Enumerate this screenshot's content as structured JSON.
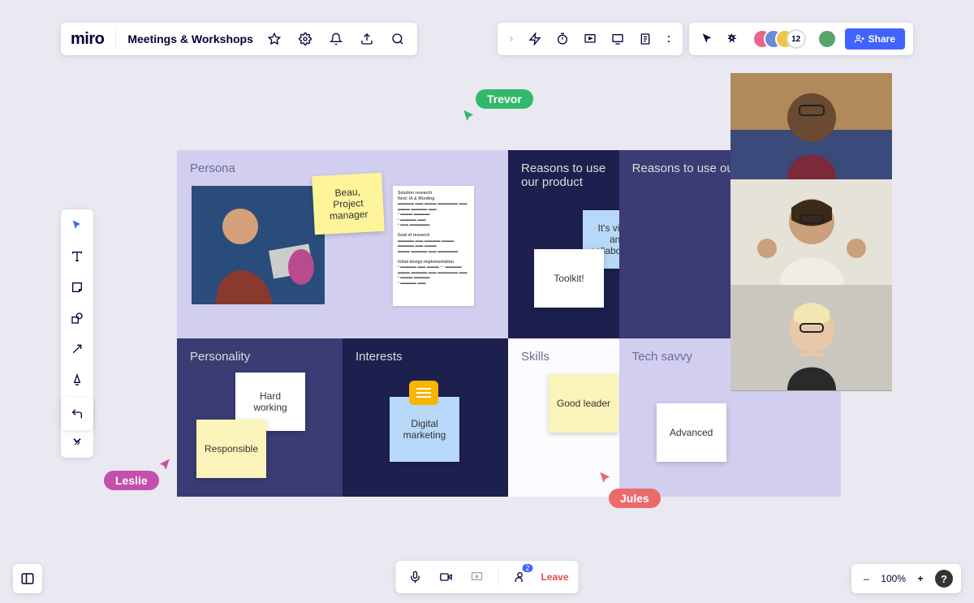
{
  "header": {
    "logo": "miro",
    "board_title": "Meetings & Workshops",
    "share_label": "Share",
    "participant_count": "12"
  },
  "cursors": {
    "trevor": "Trevor",
    "leslie": "Leslie",
    "jules": "Jules"
  },
  "grid": {
    "persona": {
      "title": "Persona"
    },
    "reasons1": {
      "title": "Reasons to use our product"
    },
    "reasons2": {
      "title": "Reasons to use our product"
    },
    "personality": {
      "title": "Personality"
    },
    "interests": {
      "title": "Interests"
    },
    "skills": {
      "title": "Skills"
    },
    "tech": {
      "title": "Tech savvy"
    }
  },
  "stickies": {
    "beau": "Beau, Project manager",
    "visual": "It's visual and collaborative",
    "toolkit": "Toolkit!",
    "hardworking": "Hard working",
    "responsible": "Responsible",
    "digitalmkt": "Digital marketing",
    "goodleader": "Good leader",
    "advanced": "Advanced"
  },
  "doc": {
    "h1": "Solution research",
    "h2": "Next: IA & Wording",
    "h3": "Goal of research",
    "h4": "Initial design implementation"
  },
  "meetingbar": {
    "leave": "Leave",
    "participant_badge": "2"
  },
  "zoom": {
    "level": "100%"
  }
}
